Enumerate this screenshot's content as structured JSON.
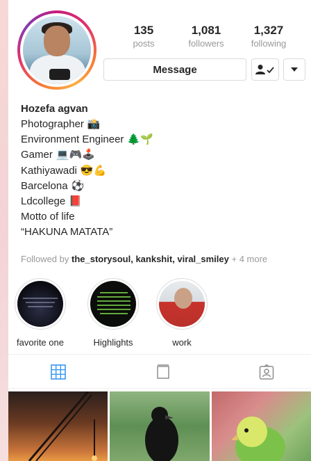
{
  "profile": {
    "name": "Hozefa agvan",
    "stats": [
      {
        "value": "135",
        "label": "posts"
      },
      {
        "value": "1,081",
        "label": "followers"
      },
      {
        "value": "1,327",
        "label": "following"
      }
    ],
    "message_label": "Message"
  },
  "bio": {
    "lines": [
      {
        "text": "Photographer",
        "emoji": "📸"
      },
      {
        "text": "Environment Engineer",
        "emoji": "🌲🌱"
      },
      {
        "text": "Gamer",
        "emoji": "💻🎮🕹️"
      },
      {
        "text": "Kathiyawadi",
        "emoji": "😎💪"
      },
      {
        "text": "Barcelona",
        "emoji": "⚽"
      },
      {
        "text": "Ldcollege",
        "emoji": "📕"
      },
      {
        "text": "Motto of life",
        "emoji": ""
      },
      {
        "text": "“HAKUNA MATATA”",
        "emoji": ""
      }
    ],
    "followed_prefix": "Followed by ",
    "followed_users": "the_storysoul, kankshit, viral_smiley",
    "followed_more": " + 4 more"
  },
  "highlights": [
    {
      "label": "favorite one"
    },
    {
      "label": "Highlights"
    },
    {
      "label": "work"
    }
  ],
  "tabs": [
    "grid-icon",
    "feed-icon",
    "tagged-icon"
  ],
  "colors": {
    "active_tab": "#3897f0",
    "inactive_icon": "#8e8e8e",
    "text": "#262626",
    "muted": "#999999"
  }
}
